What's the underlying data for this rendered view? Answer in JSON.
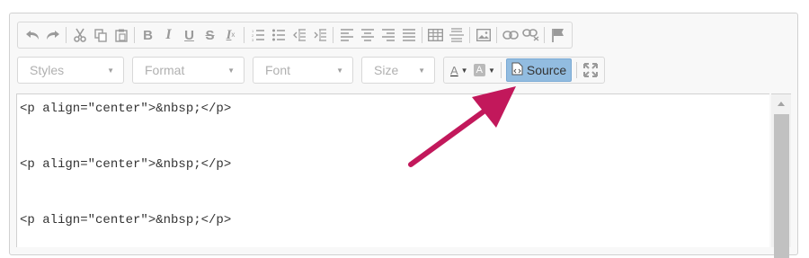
{
  "toolbar": {
    "row1_groups": [
      [
        "undo-icon",
        "redo-icon",
        "|",
        "cut-icon",
        "copy-icon",
        "paste-icon",
        "|",
        "bold-icon",
        "italic-icon",
        "underline-icon",
        "strikethrough-icon",
        "remove-format-icon",
        "|",
        "numbered-list-icon",
        "bulleted-list-icon",
        "decrease-indent-icon",
        "increase-indent-icon",
        "|",
        "align-left-icon",
        "align-center-icon",
        "align-right-icon",
        "justify-icon",
        "|",
        "table-icon",
        "horizontal-line-icon",
        "|",
        "image-icon",
        "|",
        "link-icon",
        "unlink-icon",
        "|",
        "anchor-flag-icon"
      ]
    ],
    "styles_label": "Styles",
    "format_label": "Format",
    "font_label": "Font",
    "size_label": "Size",
    "text_color_letter": "A",
    "bg_color_letter": "A",
    "source_label": "Source"
  },
  "editor": {
    "lines": [
      "<p align=\"center\">&nbsp;</p>",
      "<p align=\"center\">&nbsp;</p>",
      "<p align=\"center\">&nbsp;</p>"
    ]
  },
  "colors": {
    "source_active": "#92bce0",
    "annotation_arrow": "#c2185b"
  }
}
